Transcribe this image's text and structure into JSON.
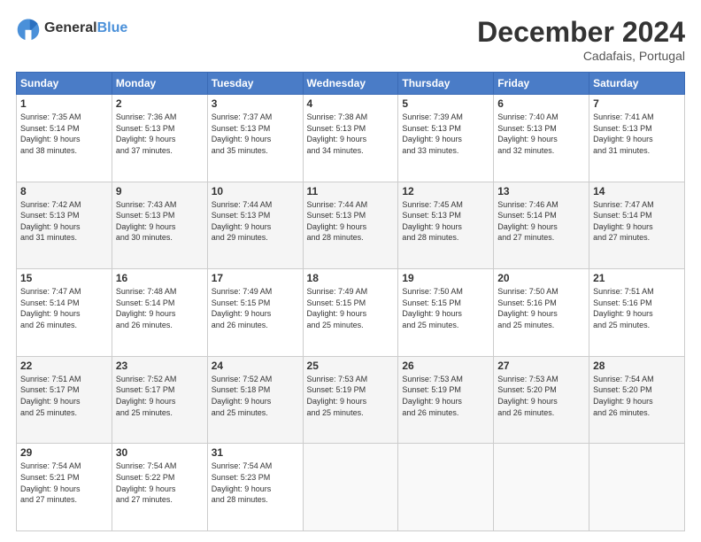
{
  "header": {
    "logo_general": "General",
    "logo_blue": "Blue",
    "title": "December 2024",
    "location": "Cadafais, Portugal"
  },
  "weekdays": [
    "Sunday",
    "Monday",
    "Tuesday",
    "Wednesday",
    "Thursday",
    "Friday",
    "Saturday"
  ],
  "weeks": [
    [
      {
        "day": "1",
        "info": "Sunrise: 7:35 AM\nSunset: 5:14 PM\nDaylight: 9 hours\nand 38 minutes."
      },
      {
        "day": "2",
        "info": "Sunrise: 7:36 AM\nSunset: 5:13 PM\nDaylight: 9 hours\nand 37 minutes."
      },
      {
        "day": "3",
        "info": "Sunrise: 7:37 AM\nSunset: 5:13 PM\nDaylight: 9 hours\nand 35 minutes."
      },
      {
        "day": "4",
        "info": "Sunrise: 7:38 AM\nSunset: 5:13 PM\nDaylight: 9 hours\nand 34 minutes."
      },
      {
        "day": "5",
        "info": "Sunrise: 7:39 AM\nSunset: 5:13 PM\nDaylight: 9 hours\nand 33 minutes."
      },
      {
        "day": "6",
        "info": "Sunrise: 7:40 AM\nSunset: 5:13 PM\nDaylight: 9 hours\nand 32 minutes."
      },
      {
        "day": "7",
        "info": "Sunrise: 7:41 AM\nSunset: 5:13 PM\nDaylight: 9 hours\nand 31 minutes."
      }
    ],
    [
      {
        "day": "8",
        "info": "Sunrise: 7:42 AM\nSunset: 5:13 PM\nDaylight: 9 hours\nand 31 minutes."
      },
      {
        "day": "9",
        "info": "Sunrise: 7:43 AM\nSunset: 5:13 PM\nDaylight: 9 hours\nand 30 minutes."
      },
      {
        "day": "10",
        "info": "Sunrise: 7:44 AM\nSunset: 5:13 PM\nDaylight: 9 hours\nand 29 minutes."
      },
      {
        "day": "11",
        "info": "Sunrise: 7:44 AM\nSunset: 5:13 PM\nDaylight: 9 hours\nand 28 minutes."
      },
      {
        "day": "12",
        "info": "Sunrise: 7:45 AM\nSunset: 5:13 PM\nDaylight: 9 hours\nand 28 minutes."
      },
      {
        "day": "13",
        "info": "Sunrise: 7:46 AM\nSunset: 5:14 PM\nDaylight: 9 hours\nand 27 minutes."
      },
      {
        "day": "14",
        "info": "Sunrise: 7:47 AM\nSunset: 5:14 PM\nDaylight: 9 hours\nand 27 minutes."
      }
    ],
    [
      {
        "day": "15",
        "info": "Sunrise: 7:47 AM\nSunset: 5:14 PM\nDaylight: 9 hours\nand 26 minutes."
      },
      {
        "day": "16",
        "info": "Sunrise: 7:48 AM\nSunset: 5:14 PM\nDaylight: 9 hours\nand 26 minutes."
      },
      {
        "day": "17",
        "info": "Sunrise: 7:49 AM\nSunset: 5:15 PM\nDaylight: 9 hours\nand 26 minutes."
      },
      {
        "day": "18",
        "info": "Sunrise: 7:49 AM\nSunset: 5:15 PM\nDaylight: 9 hours\nand 25 minutes."
      },
      {
        "day": "19",
        "info": "Sunrise: 7:50 AM\nSunset: 5:15 PM\nDaylight: 9 hours\nand 25 minutes."
      },
      {
        "day": "20",
        "info": "Sunrise: 7:50 AM\nSunset: 5:16 PM\nDaylight: 9 hours\nand 25 minutes."
      },
      {
        "day": "21",
        "info": "Sunrise: 7:51 AM\nSunset: 5:16 PM\nDaylight: 9 hours\nand 25 minutes."
      }
    ],
    [
      {
        "day": "22",
        "info": "Sunrise: 7:51 AM\nSunset: 5:17 PM\nDaylight: 9 hours\nand 25 minutes."
      },
      {
        "day": "23",
        "info": "Sunrise: 7:52 AM\nSunset: 5:17 PM\nDaylight: 9 hours\nand 25 minutes."
      },
      {
        "day": "24",
        "info": "Sunrise: 7:52 AM\nSunset: 5:18 PM\nDaylight: 9 hours\nand 25 minutes."
      },
      {
        "day": "25",
        "info": "Sunrise: 7:53 AM\nSunset: 5:19 PM\nDaylight: 9 hours\nand 25 minutes."
      },
      {
        "day": "26",
        "info": "Sunrise: 7:53 AM\nSunset: 5:19 PM\nDaylight: 9 hours\nand 26 minutes."
      },
      {
        "day": "27",
        "info": "Sunrise: 7:53 AM\nSunset: 5:20 PM\nDaylight: 9 hours\nand 26 minutes."
      },
      {
        "day": "28",
        "info": "Sunrise: 7:54 AM\nSunset: 5:20 PM\nDaylight: 9 hours\nand 26 minutes."
      }
    ],
    [
      {
        "day": "29",
        "info": "Sunrise: 7:54 AM\nSunset: 5:21 PM\nDaylight: 9 hours\nand 27 minutes."
      },
      {
        "day": "30",
        "info": "Sunrise: 7:54 AM\nSunset: 5:22 PM\nDaylight: 9 hours\nand 27 minutes."
      },
      {
        "day": "31",
        "info": "Sunrise: 7:54 AM\nSunset: 5:23 PM\nDaylight: 9 hours\nand 28 minutes."
      },
      {
        "day": "",
        "info": ""
      },
      {
        "day": "",
        "info": ""
      },
      {
        "day": "",
        "info": ""
      },
      {
        "day": "",
        "info": ""
      }
    ]
  ]
}
